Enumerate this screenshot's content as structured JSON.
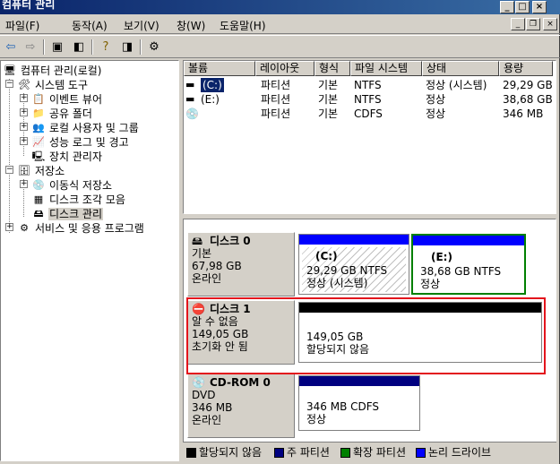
{
  "window": {
    "title": "컴퓨터 관리"
  },
  "menu": [
    "파일(F)",
    "동작(A)",
    "보기(V)",
    "창(W)",
    "도움말(H)"
  ],
  "tree": {
    "root": "컴퓨터 관리(로컬)",
    "system_tools": "시스템 도구",
    "event_viewer": "이벤트 뷰어",
    "shared_folders": "공유 폴더",
    "local_users": "로컬 사용자 및 그룹",
    "perf_logs": "성능 로그 및 경고",
    "device_manager": "장치 관리자",
    "storage": "저장소",
    "removable": "이동식 저장소",
    "defrag": "디스크 조각 모음",
    "disk_mgmt": "디스크 관리",
    "services": "서비스 및 응용 프로그램"
  },
  "volumes": {
    "headers": [
      "볼륨",
      "레이아웃",
      "형식",
      "파일 시스템",
      "상태",
      "용량"
    ],
    "rows": [
      [
        "(C:)",
        "파티션",
        "기본",
        "NTFS",
        "정상 (시스템)",
        "29,29 GB"
      ],
      [
        "(E:)",
        "파티션",
        "기본",
        "NTFS",
        "정상",
        "38,68 GB"
      ],
      [
        "",
        "파티션",
        "기본",
        "CDFS",
        "정상",
        "346 MB"
      ]
    ]
  },
  "disks": [
    {
      "name": "디스크 0",
      "lines": [
        "기본",
        "67,98 GB",
        "온라인"
      ],
      "partitions": [
        {
          "label": "(C:)",
          "size": "29,29 GB NTFS",
          "status": "정상 (시스템)",
          "color": "#0000ff"
        },
        {
          "label": "(E:)",
          "size": "38,68 GB NTFS",
          "status": "정상",
          "color": "#0000ff"
        }
      ]
    },
    {
      "name": "디스크 1",
      "lines": [
        "알 수 없음",
        "149,05 GB",
        "초기화 안 됨"
      ],
      "partitions": [
        {
          "size": "149,05 GB",
          "status": "할당되지 않음",
          "color": "#000000"
        }
      ]
    },
    {
      "name": "CD-ROM 0",
      "lines": [
        "DVD",
        "346 MB",
        "온라인"
      ],
      "partitions": [
        {
          "size": "346 MB CDFS",
          "status": "정상",
          "color": "#000080"
        }
      ]
    }
  ],
  "legend": [
    {
      "label": "할당되지 않음",
      "color": "#000000"
    },
    {
      "label": "주 파티션",
      "color": "#000080"
    },
    {
      "label": "확장 파티션",
      "color": "#008000"
    },
    {
      "label": "논리 드라이브",
      "color": "#0000ff"
    }
  ],
  "colors": {
    "highlight": "#e3141c",
    "selection": "#0a246a",
    "extended": "#008000"
  }
}
